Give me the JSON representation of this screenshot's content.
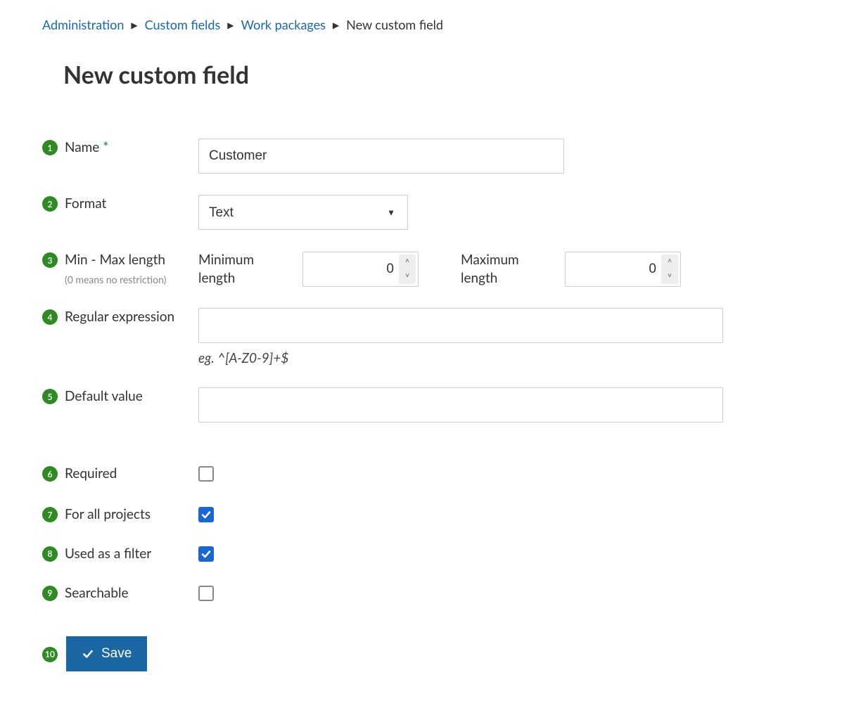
{
  "breadcrumb": {
    "items": [
      {
        "label": "Administration",
        "link": true
      },
      {
        "label": "Custom fields",
        "link": true
      },
      {
        "label": "Work packages",
        "link": true
      },
      {
        "label": "New custom field",
        "link": false
      }
    ]
  },
  "title": "New custom field",
  "badges": [
    "1",
    "2",
    "3",
    "4",
    "5",
    "6",
    "7",
    "8",
    "9",
    "10"
  ],
  "fields": {
    "name": {
      "label": "Name",
      "required_mark": "*",
      "value": "Customer"
    },
    "format": {
      "label": "Format",
      "value": "Text"
    },
    "lengths": {
      "label": "Min - Max length",
      "hint": "(0 means no restriction)",
      "min_label": "Minimum length",
      "max_label": "Maximum length",
      "min_value": "0",
      "max_value": "0"
    },
    "regex": {
      "label": "Regular expression",
      "value": "",
      "hint": "eg. ^[A-Z0-9]+$"
    },
    "default": {
      "label": "Default value",
      "value": ""
    },
    "required": {
      "label": "Required",
      "checked": false
    },
    "for_all": {
      "label": "For all projects",
      "checked": true
    },
    "as_filter": {
      "label": "Used as a filter",
      "checked": true
    },
    "searchable": {
      "label": "Searchable",
      "checked": false
    }
  },
  "save_label": "Save"
}
